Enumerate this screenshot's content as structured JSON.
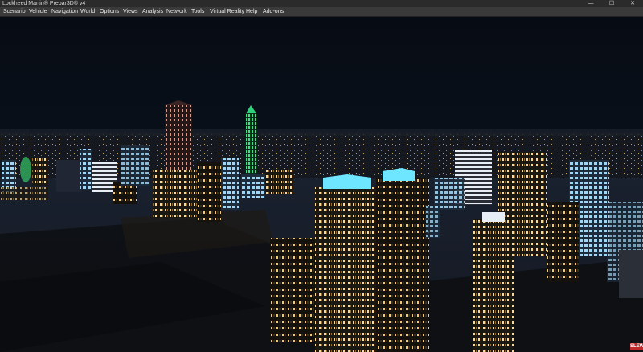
{
  "window": {
    "title": "Lockheed Martin® Prepar3D® v4",
    "controls": {
      "minimize": "—",
      "maximize": "☐",
      "close": "✕"
    }
  },
  "menubar": {
    "items": [
      {
        "label": "Scenario"
      },
      {
        "label": "Vehicle"
      },
      {
        "label": "Navigation"
      },
      {
        "label": "World"
      },
      {
        "label": "Options"
      },
      {
        "label": "Views"
      },
      {
        "label": "Analysis"
      },
      {
        "label": "Network"
      },
      {
        "label": "Tools"
      },
      {
        "label": "Virtual Reality"
      },
      {
        "label": "Help"
      },
      {
        "label": "Add-ons"
      }
    ]
  },
  "viewport": {
    "scene": "night-city-view",
    "indicator": "SLEW"
  },
  "colors": {
    "sky": "#0a111c",
    "ground": "#12151a",
    "window_light": "#ffd98a",
    "cool_light": "#b8e8ff",
    "rooftop_cyan": "#6fe6ff",
    "tower_green": "#2fd17a",
    "titlebar": "#2b2b2b",
    "menubar": "#3a3a3a",
    "indicator": "#c0282a"
  }
}
